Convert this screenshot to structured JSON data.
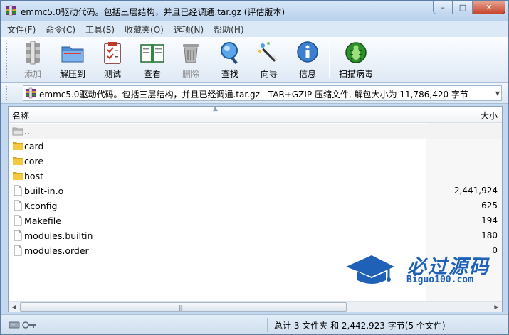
{
  "window": {
    "title": "emmc5.0驱动代码。包括三层结构，并且已经调通.tar.gz (评估版本)",
    "buttons": {
      "minimize": "–",
      "maximize": "□",
      "close": "✕"
    }
  },
  "menu": [
    "文件(F)",
    "命令(C)",
    "工具(S)",
    "收藏夹(O)",
    "选项(N)",
    "帮助(H)"
  ],
  "toolbar": {
    "add": "添加",
    "extract": "解压到",
    "test": "测试",
    "view": "查看",
    "delete": "删除",
    "find": "查找",
    "wizard": "向导",
    "info": "信息",
    "scan": "扫描病毒"
  },
  "address": {
    "text": "emmc5.0驱动代码。包括三层结构，并且已经调通.tar.gz - TAR+GZIP 压缩文件, 解包大小为 11,786,420 字节"
  },
  "columns": {
    "name": "名称",
    "size": "大小"
  },
  "files": [
    {
      "name": "..",
      "size": "",
      "type": "up"
    },
    {
      "name": "card",
      "size": "",
      "type": "folder"
    },
    {
      "name": "core",
      "size": "",
      "type": "folder"
    },
    {
      "name": "host",
      "size": "",
      "type": "folder"
    },
    {
      "name": "built-in.o",
      "size": "2,441,924",
      "type": "file"
    },
    {
      "name": "Kconfig",
      "size": "625",
      "type": "file"
    },
    {
      "name": "Makefile",
      "size": "194",
      "type": "file"
    },
    {
      "name": "modules.builtin",
      "size": "180",
      "type": "file"
    },
    {
      "name": "modules.order",
      "size": "0",
      "type": "file"
    }
  ],
  "watermark": {
    "title": "必过源码",
    "subtitle": "Biguo100.com"
  },
  "status": {
    "text": "总计 3 文件夹 和 2,442,923 字节(5 个文件)"
  }
}
